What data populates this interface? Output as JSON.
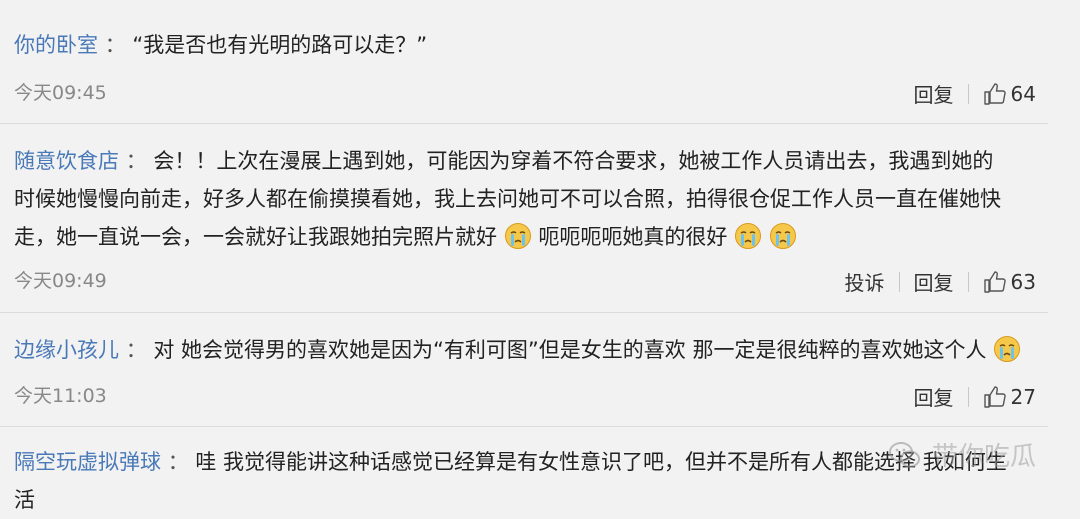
{
  "comments": [
    {
      "user": "你的卧室",
      "sep": "：",
      "lines": [
        "“我是否也有光明的路可以走？”"
      ],
      "time": "今天09:45",
      "reply": "回复",
      "likes": "64"
    },
    {
      "user": "随意饮食店",
      "sep": "：",
      "lines": [
        "会！！上次在漫展上遇到她，可能因为穿着不符合要求，她被工作人员请出去，我遇到她的",
        "时候她慢慢向前走，好多人都在偷摸摸看她，我上去问她可不可以合照，拍得很仓促工作人员一直在催她快",
        "走，她一直说一会，一会就好让我跟她拍完照片就好",
        "呃呃呃呃她真的很好"
      ],
      "time": "今天09:49",
      "report": "投诉",
      "reply": "回复",
      "likes": "63"
    },
    {
      "user": "边缘小孩儿",
      "sep": "：",
      "lines": [
        "对 她会觉得男的喜欢她是因为“有利可图”但是女生的喜欢 那一定是很纯粹的喜欢她这个人"
      ],
      "time": "今天11:03",
      "reply": "回复",
      "likes": "27"
    },
    {
      "user": "隔空玩虚拟弹球",
      "sep": "：",
      "lines": [
        "哇 我觉得能讲这种话感觉已经算是有女性意识了吧，但并不是所有人都能选择 我如何生",
        "活"
      ]
    }
  ],
  "watermark": "带你吃瓜",
  "icons": {
    "like": "thumbs-up-icon",
    "emoji": "crying-face-icon",
    "watermark": "wechat-icon"
  }
}
